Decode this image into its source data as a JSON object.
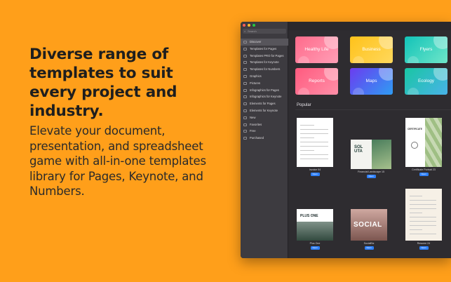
{
  "promo": {
    "headline": "Diverse range of templates to suit every project and industry.",
    "description": "Elevate your document, presentation, and spreadsheet game with all-in-one templates library for Pages, Keynote, and Numbers."
  },
  "window": {
    "traffic_colors": [
      "#ff5f57",
      "#febc2e",
      "#28c840"
    ],
    "search_placeholder": "Search",
    "search_icon": "search-icon"
  },
  "sidebar": {
    "items": [
      {
        "label": "Discover",
        "active": true
      },
      {
        "label": "Templates for Pages"
      },
      {
        "label": "Templates PRO for Pages"
      },
      {
        "label": "Templates for Keynote"
      },
      {
        "label": "Templates for Numbers"
      },
      {
        "label": "Graphics"
      },
      {
        "label": "Pictures"
      },
      {
        "label": "Infographics for Pages"
      },
      {
        "label": "Infographics for Keynote"
      },
      {
        "label": "Elements for Pages"
      },
      {
        "label": "Elements for Keynote"
      },
      {
        "label": "New"
      },
      {
        "label": "Favorites"
      },
      {
        "label": "Free"
      },
      {
        "label": "Purchased"
      }
    ]
  },
  "categories": [
    {
      "label": "Healthy Life",
      "color_a": "#ff6b8b",
      "color_b": "#ff9eb6"
    },
    {
      "label": "Business",
      "color_a": "#ffc21a",
      "color_b": "#ffd85c"
    },
    {
      "label": "Flyers",
      "color_a": "#12c3b8",
      "color_b": "#6fe6c9"
    },
    {
      "label": "Reports",
      "color_a": "#ff5b7f",
      "color_b": "#ff8fa8"
    },
    {
      "label": "Maps",
      "color_a": "#6b3cf0",
      "color_b": "#2f9cf3"
    },
    {
      "label": "Ecology",
      "color_a": "#19c6a3",
      "color_b": "#49b3e8"
    }
  ],
  "popular": {
    "title": "Popular",
    "open_label": "Open",
    "items": [
      {
        "name": "Invoice 04"
      },
      {
        "name": "Financial Landscape 15"
      },
      {
        "name": "Certificate Portrait 23"
      },
      {
        "name": "Plus One"
      },
      {
        "name": "SocialBiz"
      },
      {
        "name": "Resume 24"
      }
    ],
    "thumb_texts": {
      "solita": "SOL UTA",
      "certificate": "CERTIFICATE",
      "plus_one": "PLUS ONE",
      "social": "SOCIAL"
    }
  }
}
